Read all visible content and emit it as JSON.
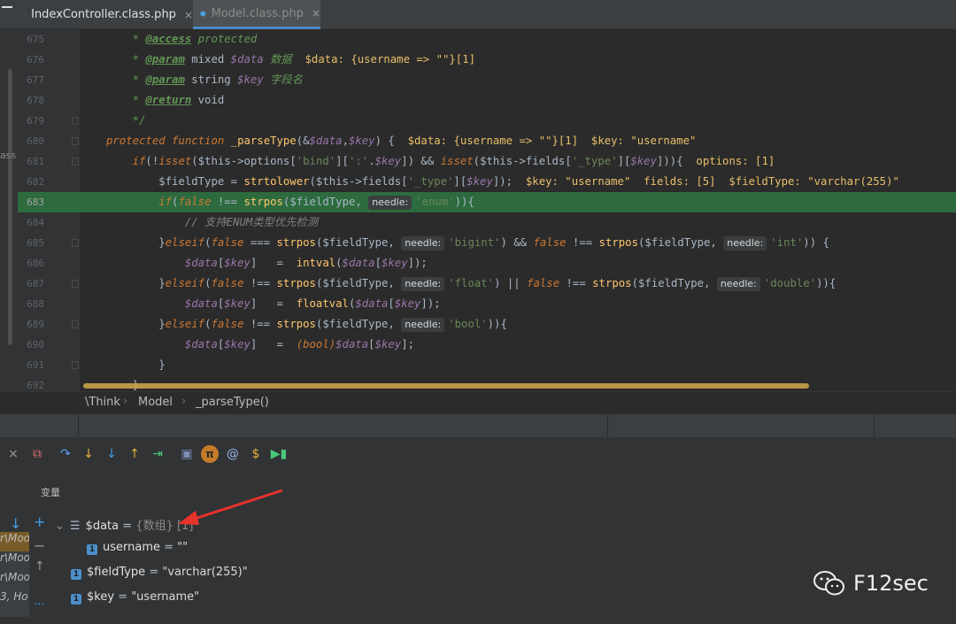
{
  "tabs": [
    {
      "label": "IndexController.class.php",
      "close": "×"
    },
    {
      "label": "Model.class.php",
      "close": "×"
    }
  ],
  "left_fragment": "ass",
  "code_lines": [
    {
      "num": "675",
      "segments": [
        {
          "c": "t-doc",
          "t": "    * "
        },
        {
          "c": "t-tag",
          "t": "@access"
        },
        {
          "c": "t-doc",
          "t": " protected"
        }
      ]
    },
    {
      "num": "676",
      "segments": [
        {
          "c": "t-doc",
          "t": "    * "
        },
        {
          "c": "t-tag",
          "t": "@param"
        },
        {
          "c": "t-plain",
          "t": " mixed "
        },
        {
          "c": "t-var",
          "t": "$data"
        },
        {
          "c": "t-doc",
          "t": " 数据  "
        },
        {
          "c": "t-inl",
          "t": "$data: {username => \"\"}[1]"
        }
      ]
    },
    {
      "num": "677",
      "segments": [
        {
          "c": "t-doc",
          "t": "    * "
        },
        {
          "c": "t-tag",
          "t": "@param"
        },
        {
          "c": "t-plain",
          "t": " string "
        },
        {
          "c": "t-var",
          "t": "$key"
        },
        {
          "c": "t-doc",
          "t": " 字段名"
        }
      ]
    },
    {
      "num": "678",
      "segments": [
        {
          "c": "t-doc",
          "t": "    * "
        },
        {
          "c": "t-tag",
          "t": "@return"
        },
        {
          "c": "t-plain",
          "t": " void"
        }
      ]
    },
    {
      "num": "679",
      "segments": [
        {
          "c": "t-doc",
          "t": "    */"
        }
      ]
    },
    {
      "num": "680",
      "segments": [
        {
          "c": "t-kw",
          "t": "protected function "
        },
        {
          "c": "t-fn",
          "t": "_parseType"
        },
        {
          "c": "t-plain",
          "t": "(&"
        },
        {
          "c": "t-var",
          "t": "$data"
        },
        {
          "c": "t-plain",
          "t": ","
        },
        {
          "c": "t-var",
          "t": "$key"
        },
        {
          "c": "t-plain",
          "t": ") {  "
        },
        {
          "c": "t-inl",
          "t": "$data: {username => \"\"}[1]  $key: \"username\""
        }
      ]
    },
    {
      "num": "681",
      "segments": [
        {
          "c": "t-kw",
          "t": "    if"
        },
        {
          "c": "t-plain",
          "t": "(!"
        },
        {
          "c": "t-kw",
          "t": "isset"
        },
        {
          "c": "t-plain",
          "t": "($this->options["
        },
        {
          "c": "t-str",
          "t": "'bind'"
        },
        {
          "c": "t-plain",
          "t": "]["
        },
        {
          "c": "t-str",
          "t": "':'"
        },
        {
          "c": "t-plain",
          "t": "."
        },
        {
          "c": "t-var",
          "t": "$key"
        },
        {
          "c": "t-plain",
          "t": "]) && "
        },
        {
          "c": "t-kw",
          "t": "isset"
        },
        {
          "c": "t-plain",
          "t": "($this->fields["
        },
        {
          "c": "t-str",
          "t": "'_type'"
        },
        {
          "c": "t-plain",
          "t": "]["
        },
        {
          "c": "t-var",
          "t": "$key"
        },
        {
          "c": "t-plain",
          "t": "])){  "
        },
        {
          "c": "t-inl",
          "t": "options: [1]"
        }
      ]
    },
    {
      "num": "682",
      "segments": [
        {
          "c": "t-plain",
          "t": "        $fieldType = "
        },
        {
          "c": "t-fn",
          "t": "strtolower"
        },
        {
          "c": "t-plain",
          "t": "($this->fields["
        },
        {
          "c": "t-str",
          "t": "'_type'"
        },
        {
          "c": "t-plain",
          "t": "]["
        },
        {
          "c": "t-var",
          "t": "$key"
        },
        {
          "c": "t-plain",
          "t": "]);  "
        },
        {
          "c": "t-inl",
          "t": "$key: \"username\"  fields: [5]  $fieldType: \"varchar(255)\""
        }
      ]
    },
    {
      "num": "683",
      "hl": true,
      "segments": [
        {
          "c": "t-kw",
          "t": "        if"
        },
        {
          "c": "t-plain",
          "t": "("
        },
        {
          "c": "t-kw",
          "t": "false"
        },
        {
          "c": "t-plain",
          "t": " !== "
        },
        {
          "c": "t-fn",
          "t": "strpos"
        },
        {
          "c": "t-plain",
          "t": "($fieldType, "
        },
        {
          "c": "hint",
          "t": "needle:"
        },
        {
          "c": "t-str",
          "t": "'enum'"
        },
        {
          "c": "t-plain",
          "t": ")){"
        }
      ]
    },
    {
      "num": "684",
      "segments": [
        {
          "c": "t-lcm",
          "t": "            // 支持ENUM类型优先检测"
        }
      ]
    },
    {
      "num": "685",
      "segments": [
        {
          "c": "t-plain",
          "t": "        }"
        },
        {
          "c": "t-kw",
          "t": "elseif"
        },
        {
          "c": "t-plain",
          "t": "("
        },
        {
          "c": "t-kw",
          "t": "false"
        },
        {
          "c": "t-plain",
          "t": " === "
        },
        {
          "c": "t-fn",
          "t": "strpos"
        },
        {
          "c": "t-plain",
          "t": "($fieldType, "
        },
        {
          "c": "hint",
          "t": "needle:"
        },
        {
          "c": "t-str",
          "t": "'bigint'"
        },
        {
          "c": "t-plain",
          "t": ") && "
        },
        {
          "c": "t-kw",
          "t": "false"
        },
        {
          "c": "t-plain",
          "t": " !== "
        },
        {
          "c": "t-fn",
          "t": "strpos"
        },
        {
          "c": "t-plain",
          "t": "($fieldType, "
        },
        {
          "c": "hint",
          "t": "needle:"
        },
        {
          "c": "t-str",
          "t": "'int'"
        },
        {
          "c": "t-plain",
          "t": ")) {"
        }
      ]
    },
    {
      "num": "686",
      "segments": [
        {
          "c": "t-var",
          "t": "            $data"
        },
        {
          "c": "t-plain",
          "t": "["
        },
        {
          "c": "t-var",
          "t": "$key"
        },
        {
          "c": "t-plain",
          "t": "]   =  "
        },
        {
          "c": "t-fn",
          "t": "intval"
        },
        {
          "c": "t-plain",
          "t": "("
        },
        {
          "c": "t-var",
          "t": "$data"
        },
        {
          "c": "t-plain",
          "t": "["
        },
        {
          "c": "t-var",
          "t": "$key"
        },
        {
          "c": "t-plain",
          "t": "]);"
        }
      ]
    },
    {
      "num": "687",
      "segments": [
        {
          "c": "t-plain",
          "t": "        }"
        },
        {
          "c": "t-kw",
          "t": "elseif"
        },
        {
          "c": "t-plain",
          "t": "("
        },
        {
          "c": "t-kw",
          "t": "false"
        },
        {
          "c": "t-plain",
          "t": " !== "
        },
        {
          "c": "t-fn",
          "t": "strpos"
        },
        {
          "c": "t-plain",
          "t": "($fieldType, "
        },
        {
          "c": "hint",
          "t": "needle:"
        },
        {
          "c": "t-str",
          "t": "'float'"
        },
        {
          "c": "t-plain",
          "t": ") || "
        },
        {
          "c": "t-kw",
          "t": "false"
        },
        {
          "c": "t-plain",
          "t": " !== "
        },
        {
          "c": "t-fn",
          "t": "strpos"
        },
        {
          "c": "t-plain",
          "t": "($fieldType, "
        },
        {
          "c": "hint",
          "t": "needle:"
        },
        {
          "c": "t-str",
          "t": "'double'"
        },
        {
          "c": "t-plain",
          "t": ")){"
        }
      ]
    },
    {
      "num": "688",
      "segments": [
        {
          "c": "t-var",
          "t": "            $data"
        },
        {
          "c": "t-plain",
          "t": "["
        },
        {
          "c": "t-var",
          "t": "$key"
        },
        {
          "c": "t-plain",
          "t": "]   =  "
        },
        {
          "c": "t-fn",
          "t": "floatval"
        },
        {
          "c": "t-plain",
          "t": "("
        },
        {
          "c": "t-var",
          "t": "$data"
        },
        {
          "c": "t-plain",
          "t": "["
        },
        {
          "c": "t-var",
          "t": "$key"
        },
        {
          "c": "t-plain",
          "t": "]);"
        }
      ]
    },
    {
      "num": "689",
      "segments": [
        {
          "c": "t-plain",
          "t": "        }"
        },
        {
          "c": "t-kw",
          "t": "elseif"
        },
        {
          "c": "t-plain",
          "t": "("
        },
        {
          "c": "t-kw",
          "t": "false"
        },
        {
          "c": "t-plain",
          "t": " !== "
        },
        {
          "c": "t-fn",
          "t": "strpos"
        },
        {
          "c": "t-plain",
          "t": "($fieldType, "
        },
        {
          "c": "hint",
          "t": "needle:"
        },
        {
          "c": "t-str",
          "t": "'bool'"
        },
        {
          "c": "t-plain",
          "t": ")){"
        }
      ]
    },
    {
      "num": "690",
      "segments": [
        {
          "c": "t-var",
          "t": "            $data"
        },
        {
          "c": "t-plain",
          "t": "["
        },
        {
          "c": "t-var",
          "t": "$key"
        },
        {
          "c": "t-plain",
          "t": "]   =  "
        },
        {
          "c": "t-kw",
          "t": "(bool)"
        },
        {
          "c": "t-var",
          "t": "$data"
        },
        {
          "c": "t-plain",
          "t": "["
        },
        {
          "c": "t-var",
          "t": "$key"
        },
        {
          "c": "t-plain",
          "t": "];"
        }
      ]
    },
    {
      "num": "691",
      "segments": [
        {
          "c": "t-plain",
          "t": "        }"
        }
      ]
    },
    {
      "num": "692",
      "segments": [
        {
          "c": "t-plain",
          "t": "    }"
        }
      ]
    }
  ],
  "breadcrumb": [
    "\\Think",
    "Model",
    "_parseType()"
  ],
  "debug": {
    "toolbar_icons": [
      "close-icon",
      "restore-icon",
      "step-over-icon",
      "step-into-icon",
      "force-step-into-icon",
      "step-out-icon",
      "run-to-cursor-icon",
      "console-icon",
      "evaluate-icon",
      "watch-icon",
      "dollar-icon",
      "resume-icon"
    ],
    "toolbar_glyphs": [
      "×",
      "⧉",
      "↷",
      "↓",
      "↓",
      "↑",
      "⇥",
      "▣",
      "π",
      "@",
      "$",
      "▶▮"
    ],
    "vars_label": "变量",
    "frames": [
      "r\\Moo",
      "r\\Moo",
      "r\\Moo",
      "3, Ho"
    ],
    "variables": [
      {
        "name": "$data",
        "eq": " = ",
        "type": "{数组} [1]",
        "value": ""
      },
      {
        "name": "username",
        "eq": " = ",
        "type": "",
        "value": "\"\""
      },
      {
        "name": "$fieldType",
        "eq": " = ",
        "type": "",
        "value": "\"varchar(255)\""
      },
      {
        "name": "$key",
        "eq": " = ",
        "type": "",
        "value": "\"username\""
      }
    ],
    "badge": "1",
    "more": "..."
  },
  "watermark": "F12sec",
  "colors": {
    "accent": "#4a88c7",
    "highlight_line": "#2d6b3e",
    "arrow": "#e8322c"
  }
}
